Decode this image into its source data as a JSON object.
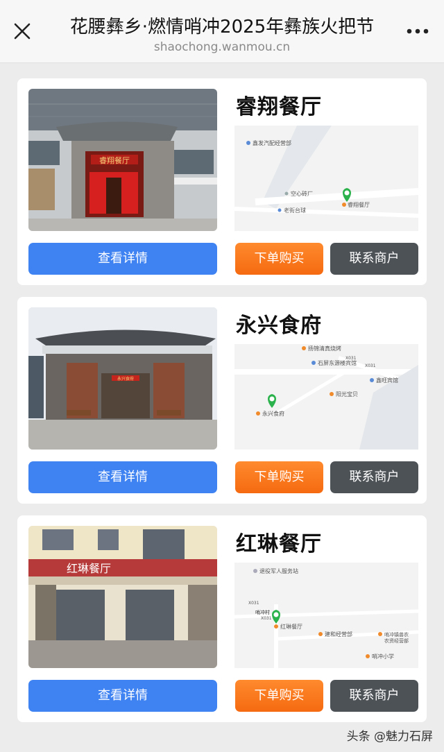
{
  "header": {
    "title": "花腰彝乡·燃情哨冲2025年彝族火把节",
    "domain": "shaochong.wanmou.cn",
    "close_icon": "close-icon",
    "more_icon": "more-dots-icon"
  },
  "buttons": {
    "detail": "查看详情",
    "buy": "下单购买",
    "contact": "联系商户"
  },
  "restaurants": [
    {
      "name": "睿翔餐厅",
      "sign": "睿翔餐厅",
      "map_labels": [
        "鑫发汽配经营部",
        "空心砖厂",
        "老街台球",
        "睿翔餐厅"
      ]
    },
    {
      "name": "永兴食府",
      "sign": "永兴食府",
      "map_labels": [
        "扬锦清真烧烤",
        "石屏东源楼宾馆",
        "鑫旺宾馆",
        "阳光宝贝",
        "永兴食府",
        "X031",
        "X031"
      ]
    },
    {
      "name": "红琳餐厅",
      "sign": "红琳餐厅",
      "map_labels": [
        "退役军人服务站",
        "X031",
        "哨冲村",
        "X031",
        "红琳餐厅",
        "建和经营部",
        "哨冲镇兽农",
        "农资经营部",
        "哨冲小学"
      ]
    }
  ],
  "colors": {
    "detail_button": "#3f83f2",
    "buy_button": "#f56a10",
    "contact_button": "#4d5257",
    "map_pin": "#2bb24c"
  },
  "watermark": "头条 @魅力石屏"
}
